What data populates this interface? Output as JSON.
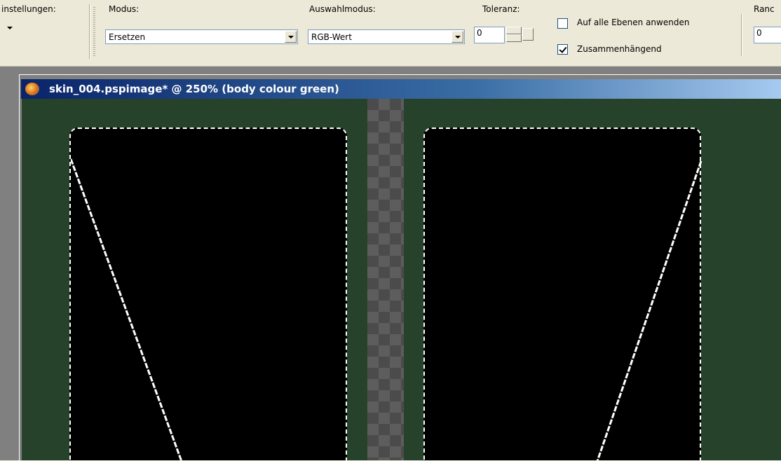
{
  "toolbar": {
    "settings_label": "instellungen:",
    "mode_label": "Modus:",
    "mode_value": "Ersetzen",
    "selection_mode_label": "Auswahlmodus:",
    "selection_mode_value": "RGB-Wert",
    "tolerance_label": "Toleranz:",
    "tolerance_value": "0",
    "all_layers_label": "Auf alle Ebenen anwenden",
    "all_layers_checked": false,
    "contiguous_label": "Zusammenhängend",
    "contiguous_checked": true,
    "edge_label": "Ranc",
    "edge_value": "0"
  },
  "document": {
    "title": "skin_004.pspimage* @ 250% (body colour green)",
    "background_color": "#26422a"
  },
  "icons": [
    "dropdown-arrow-icon",
    "combo-arrow-icon",
    "spin-up-icon",
    "spin-down-icon",
    "checkbox-icon",
    "app-document-icon"
  ]
}
